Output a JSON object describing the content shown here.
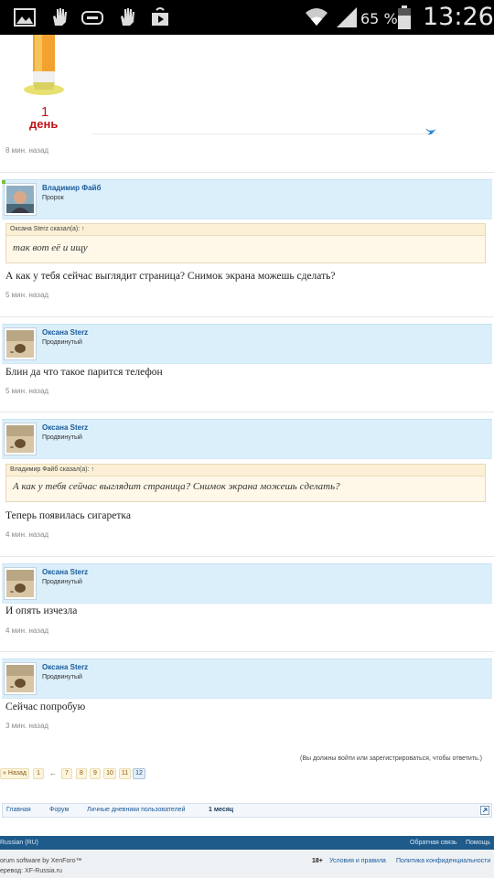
{
  "status_bar": {
    "battery": "65 %",
    "time": "13:26",
    "icons": [
      "gallery-icon",
      "hand-icon",
      "gamepad-icon",
      "hand-icon",
      "play-store-icon",
      "wifi-icon",
      "signal-icon",
      "battery-icon"
    ]
  },
  "top_post": {
    "sticker_label_1": "1",
    "sticker_label_2": "день",
    "time": "8 мин. назад"
  },
  "posts": [
    {
      "author": "Владимир Файб",
      "title": "Пророк",
      "quote_header": "Оксана Sterz сказал(а): ↑",
      "quote_text": "так вот её и ищу",
      "text": "А как у тебя сейчас выглядит страница? Снимок экрана можешь сделать?",
      "time": "5 мин. назад"
    },
    {
      "author": "Оксана Sterz",
      "title": "Продвинутый",
      "text": "Блин да что такое парится телефон",
      "time": "5 мин. назад"
    },
    {
      "author": "Оксана Sterz",
      "title": "Продвинутый",
      "quote_header": "Владимир Файб сказал(а): ↑",
      "quote_text": "А как у тебя сейчас выглядит страница? Снимок экрана можешь сделать?",
      "text": "Теперь появилась сигаретка",
      "time": "4 мин. назад"
    },
    {
      "author": "Оксана Sterz",
      "title": "Продвинутый",
      "text": "И опять изчезла",
      "time": "4 мин. назад"
    },
    {
      "author": "Оксана Sterz",
      "title": "Продвинутый",
      "text": "Сейчас попробую",
      "time": "3 мин. назад"
    }
  ],
  "login_note": "(Вы должны войти или зарегистрироваться, чтобы ответить.)",
  "pagination": {
    "prev": "« Назад",
    "pages": [
      "1",
      "←",
      "7",
      "8",
      "9",
      "10",
      "11",
      "12"
    ],
    "current": "12"
  },
  "breadcrumb": [
    "Главная",
    "Форум",
    "Личные дневники пользователей",
    "1 месяц"
  ],
  "footer": {
    "language": "Russian (RU)",
    "feedback": "Обратная связь",
    "help": "Помощь",
    "software": "orum software by XenForo™",
    "translation": "еревод: XF-Russia.ru",
    "age": "18+",
    "terms": "Условия и правила",
    "privacy": "Политика конфиденциальности"
  },
  "colors": {
    "header_bg": "#dbeffb",
    "link": "#1a5a9a",
    "quote_bg": "#fff8e9",
    "footer_bg": "#1e5a8a"
  }
}
